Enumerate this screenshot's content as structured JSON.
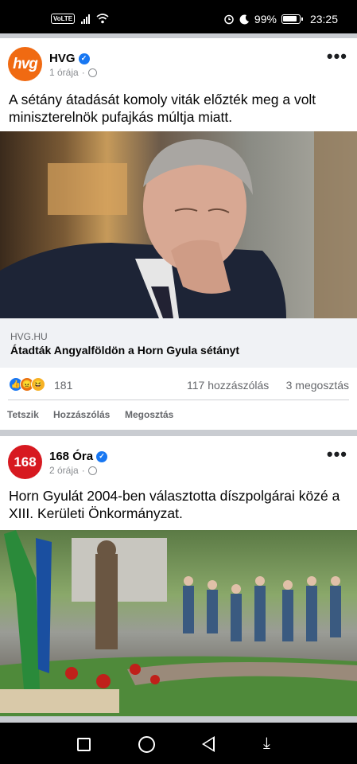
{
  "status_bar": {
    "network": "VoLTE",
    "battery": "99%",
    "time": "23:25",
    "icons": [
      "volte-icon",
      "signal-icon",
      "wifi-icon",
      "alarm-icon",
      "moon-icon",
      "battery-icon"
    ]
  },
  "posts": [
    {
      "page_name": "HVG",
      "avatar_text": "hvg",
      "time": "1 órája",
      "text": "A sétány átadását komoly viták előzték meg a volt miniszterelnök pufajkás múltja miatt.",
      "link_domain": "HVG.HU",
      "link_title": "Átadták Angyalföldön a Horn Gyula sétányt",
      "reaction_count": "181",
      "comments": "117 hozzászólás",
      "shares": "3 megosztás",
      "actions": [
        "Tetszik",
        "Hozzászólás",
        "Megosztás"
      ],
      "reaction_types": [
        "like",
        "angry",
        "haha"
      ]
    },
    {
      "page_name": "168 Óra",
      "avatar_text": "168",
      "time": "2 órája",
      "text": "Horn Gyulát 2004-ben választotta díszpolgárai közé a XIII. Kerületi Önkormányzat."
    }
  ],
  "colors": {
    "hvg_brand": "#f06a12",
    "ora168_brand": "#d71920",
    "verified": "#1877f2"
  }
}
